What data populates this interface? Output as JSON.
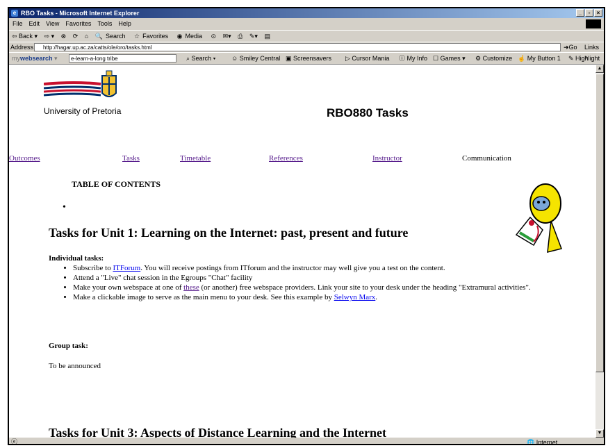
{
  "window": {
    "title": "RBO Tasks - Microsoft Internet Explorer"
  },
  "menu": [
    "File",
    "Edit",
    "View",
    "Favorites",
    "Tools",
    "Help"
  ],
  "toolbar": [
    "⇦ Back ▾",
    "⇨ ▾",
    "Search",
    "Favorites",
    "Media"
  ],
  "address": {
    "label": "Address",
    "url": "http://hagar.up.ac.za/catts/ole/oro/tasks.html",
    "go": "Go",
    "links": "Links »"
  },
  "searchbar": {
    "brand_prefix": "my",
    "brand_main": "websearch",
    "query": "e-learn-a-long tribe",
    "search": "Search",
    "items": [
      "Smiley Central",
      "Screensavers",
      "Cursor Mania",
      "My Info",
      "Games",
      "Customize",
      "My Button 1",
      "Highlight"
    ]
  },
  "page": {
    "university": "University of Pretoria",
    "title": "RBO880 Tasks",
    "nav": [
      "Outcomes",
      "Tasks",
      "Timetable",
      "References",
      "Instructor"
    ],
    "nav_current": "Communication",
    "toc": "TABLE OF CONTENTS",
    "unit1_heading": "Tasks for Unit 1: Learning on the Internet: past, present and future",
    "individual_heading": "Individual tasks:",
    "tasks": [
      {
        "before": "Subscribe to ",
        "link": "ITForum",
        "after": ". You will receive postings from ITforum and the instructor may well give you a test on the content."
      },
      {
        "before": "Attend a \"Live\" chat session in the Egroups \"Chat\" facility",
        "link": "",
        "after": ""
      },
      {
        "before": "Make your own webspace at one of ",
        "link": "these",
        "after": " (or another) free webspace providers.  Link your site to your desk under the heading \"Extramural activities\"."
      },
      {
        "before": "Make a clickable image to serve as the main menu to your desk. See this example by ",
        "link": "Selwyn Marx",
        "after": "."
      }
    ],
    "group_heading": "Group task:",
    "group_text": "To be announced",
    "unit3_heading": "Tasks for Unit 3: Aspects of Distance Learning and the Internet"
  },
  "status": {
    "zone": "Internet"
  }
}
